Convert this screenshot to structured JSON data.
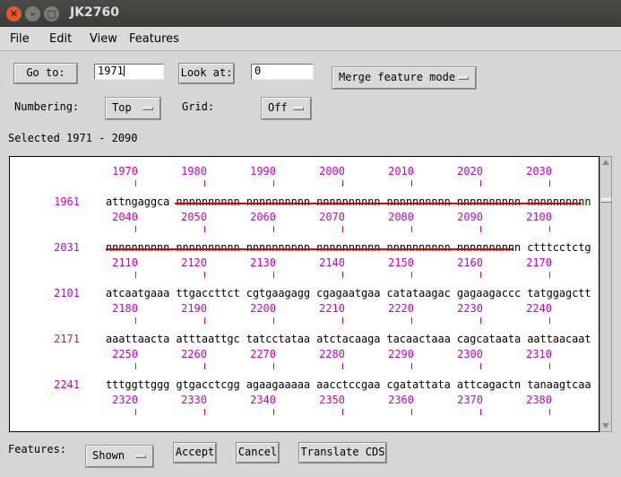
{
  "window": {
    "title": "JK2760",
    "close_glyph": "✕",
    "min_glyph": "–",
    "max_glyph": "▢"
  },
  "menu": [
    "File",
    "Edit",
    "View",
    "Features"
  ],
  "controls": {
    "goto_label": "Go to:",
    "goto_value": "1971",
    "lookat_label": "Look at:",
    "lookat_value": "0",
    "merge_mode": "Merge feature mode",
    "numbering_label": "Numbering:",
    "numbering_value": "Top",
    "grid_label": "Grid:",
    "grid_value": "Off"
  },
  "selected": "Selected 1971 - 2090",
  "sequence": {
    "rows": [
      {
        "start": "1961",
        "text": "attngaggca nnnnnnnnnn nnnnnnnnnn nnnnnnnnnn nnnnnnnnnn nnnnnnnnnn nnnnnnnnnn",
        "ticks": [
          "1970",
          "1980",
          "1990",
          "2000",
          "2010",
          "2020",
          "2030"
        ]
      },
      {
        "start": "2031",
        "text": "nnnnnnnnnn nnnnnnnnnn nnnnnnnnnn nnnnnnnnnn nnnnnnnnnn nnnnnnnnnn ctttcctctg",
        "ticks": [
          "2040",
          "2050",
          "2060",
          "2070",
          "2080",
          "2090",
          "2100"
        ]
      },
      {
        "start": "2101",
        "text": "atcaatgaaa ttgaccttct cgtgaagagg cgagaatgaa catataagac gagaagaccc tatggagctt",
        "ticks": [
          "2110",
          "2120",
          "2130",
          "2140",
          "2150",
          "2160",
          "2170"
        ]
      },
      {
        "start": "2171",
        "text": "aaattaacta atttaattgc tatcctataa atctacaaga tacaactaaa cagcataata aattaacaat",
        "ticks": [
          "2180",
          "2190",
          "2200",
          "2210",
          "2220",
          "2230",
          "2240"
        ]
      },
      {
        "start": "2241",
        "text": "tttggttggg gtgacctcgg agaagaaaaa aacctccgaa cgatattata attcagactn tanaagtcaa",
        "ticks": [
          "2250",
          "2260",
          "2270",
          "2280",
          "2290",
          "2300",
          "2310"
        ]
      }
    ],
    "bottom_ticks": [
      "2320",
      "2330",
      "2340",
      "2350",
      "2360",
      "2370",
      "2380"
    ],
    "feature_color": "#e00000",
    "number_color": "#cc00cc"
  },
  "footer": {
    "features_label": "Features:",
    "features_value": "Shown",
    "accept": "Accept",
    "cancel": "Cancel",
    "translate": "Translate CDS"
  }
}
